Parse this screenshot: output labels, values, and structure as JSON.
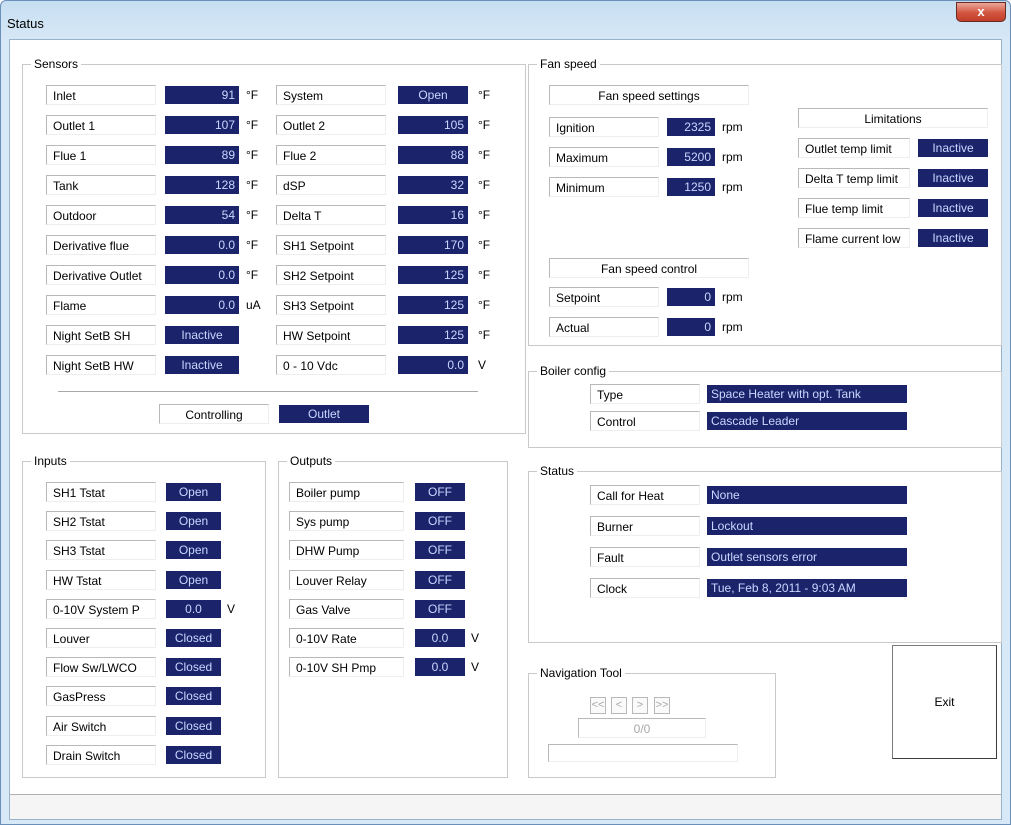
{
  "window": {
    "title": "Status",
    "close_label": "x"
  },
  "sensors": {
    "legend": "Sensors",
    "left": [
      {
        "label": "Inlet",
        "value": "91",
        "unit": "°F"
      },
      {
        "label": "Outlet 1",
        "value": "107",
        "unit": "°F"
      },
      {
        "label": "Flue 1",
        "value": "89",
        "unit": "°F"
      },
      {
        "label": "Tank",
        "value": "128",
        "unit": "°F"
      },
      {
        "label": "Outdoor",
        "value": "54",
        "unit": "°F"
      },
      {
        "label": "Derivative flue",
        "value": "0.0",
        "unit": "°F"
      },
      {
        "label": "Derivative Outlet",
        "value": "0.0",
        "unit": "°F"
      },
      {
        "label": "Flame",
        "value": "0.0",
        "unit": "uA"
      },
      {
        "label": "Night SetB SH",
        "value": "Inactive",
        "unit": ""
      },
      {
        "label": "Night SetB HW",
        "value": "Inactive",
        "unit": ""
      }
    ],
    "right": [
      {
        "label": "System",
        "value": "Open",
        "unit": "°F"
      },
      {
        "label": "Outlet 2",
        "value": "105",
        "unit": "°F"
      },
      {
        "label": "Flue 2",
        "value": "88",
        "unit": "°F"
      },
      {
        "label": "dSP",
        "value": "32",
        "unit": "°F"
      },
      {
        "label": "Delta T",
        "value": "16",
        "unit": "°F"
      },
      {
        "label": "SH1 Setpoint",
        "value": "170",
        "unit": "°F"
      },
      {
        "label": "SH2 Setpoint",
        "value": "125",
        "unit": "°F"
      },
      {
        "label": "SH3 Setpoint",
        "value": "125",
        "unit": "°F"
      },
      {
        "label": "HW Setpoint",
        "value": "125",
        "unit": "°F"
      },
      {
        "label": "0 - 10 Vdc",
        "value": "0.0",
        "unit": "V"
      }
    ],
    "controlling_label": "Controlling",
    "controlling_value": "Outlet"
  },
  "inputs": {
    "legend": "Inputs",
    "items": [
      {
        "label": "SH1 Tstat",
        "value": "Open",
        "unit": ""
      },
      {
        "label": "SH2 Tstat",
        "value": "Open",
        "unit": ""
      },
      {
        "label": "SH3 Tstat",
        "value": "Open",
        "unit": ""
      },
      {
        "label": "HW Tstat",
        "value": "Open",
        "unit": ""
      },
      {
        "label": "0-10V System P",
        "value": "0.0",
        "unit": "V"
      },
      {
        "label": "Louver",
        "value": "Closed",
        "unit": ""
      },
      {
        "label": "Flow Sw/LWCO",
        "value": "Closed",
        "unit": ""
      },
      {
        "label": "GasPress",
        "value": "Closed",
        "unit": ""
      },
      {
        "label": "Air Switch",
        "value": "Closed",
        "unit": ""
      },
      {
        "label": "Drain Switch",
        "value": "Closed",
        "unit": ""
      }
    ]
  },
  "outputs": {
    "legend": "Outputs",
    "items": [
      {
        "label": "Boiler pump",
        "value": "OFF",
        "unit": ""
      },
      {
        "label": "Sys pump",
        "value": "OFF",
        "unit": ""
      },
      {
        "label": "DHW Pump",
        "value": "OFF",
        "unit": ""
      },
      {
        "label": "Louver Relay",
        "value": "OFF",
        "unit": ""
      },
      {
        "label": "Gas Valve",
        "value": "OFF",
        "unit": ""
      },
      {
        "label": "0-10V Rate",
        "value": "0.0",
        "unit": "V"
      },
      {
        "label": "0-10V SH Pmp",
        "value": "0.0",
        "unit": "V"
      }
    ]
  },
  "fan_speed": {
    "legend": "Fan speed",
    "settings_header": "Fan speed settings",
    "settings": [
      {
        "label": "Ignition",
        "value": "2325",
        "unit": "rpm"
      },
      {
        "label": "Maximum",
        "value": "5200",
        "unit": "rpm"
      },
      {
        "label": "Minimum",
        "value": "1250",
        "unit": "rpm"
      }
    ],
    "control_header": "Fan speed control",
    "control": [
      {
        "label": "Setpoint",
        "value": "0",
        "unit": "rpm"
      },
      {
        "label": "Actual",
        "value": "0",
        "unit": "rpm"
      }
    ],
    "limitations_header": "Limitations",
    "limitations": [
      {
        "label": "Outlet temp limit",
        "value": "Inactive"
      },
      {
        "label": "Delta T temp limit",
        "value": "Inactive"
      },
      {
        "label": "Flue temp limit",
        "value": "Inactive"
      },
      {
        "label": "Flame current low",
        "value": "Inactive"
      }
    ]
  },
  "boiler_config": {
    "legend": "Boiler config",
    "items": [
      {
        "label": "Type",
        "value": "Space Heater with opt. Tank"
      },
      {
        "label": "Control",
        "value": "Cascade Leader"
      }
    ]
  },
  "status": {
    "legend": "Status",
    "items": [
      {
        "label": "Call for Heat",
        "value": "None"
      },
      {
        "label": "Burner",
        "value": "Lockout"
      },
      {
        "label": "Fault",
        "value": "Outlet sensors error"
      },
      {
        "label": "Clock",
        "value": "Tue, Feb 8, 2011 - 9:03 AM"
      }
    ]
  },
  "navigation": {
    "legend": "Navigation Tool",
    "first": "<<",
    "prev": "<",
    "next": ">",
    "last": ">>",
    "page": "0/0"
  },
  "exit_label": "Exit",
  "colors": {
    "value_bg": "#1b236b",
    "value_text": "#c8d8ff",
    "title_bar": "#c6def2",
    "close_button": "#c8492f"
  }
}
